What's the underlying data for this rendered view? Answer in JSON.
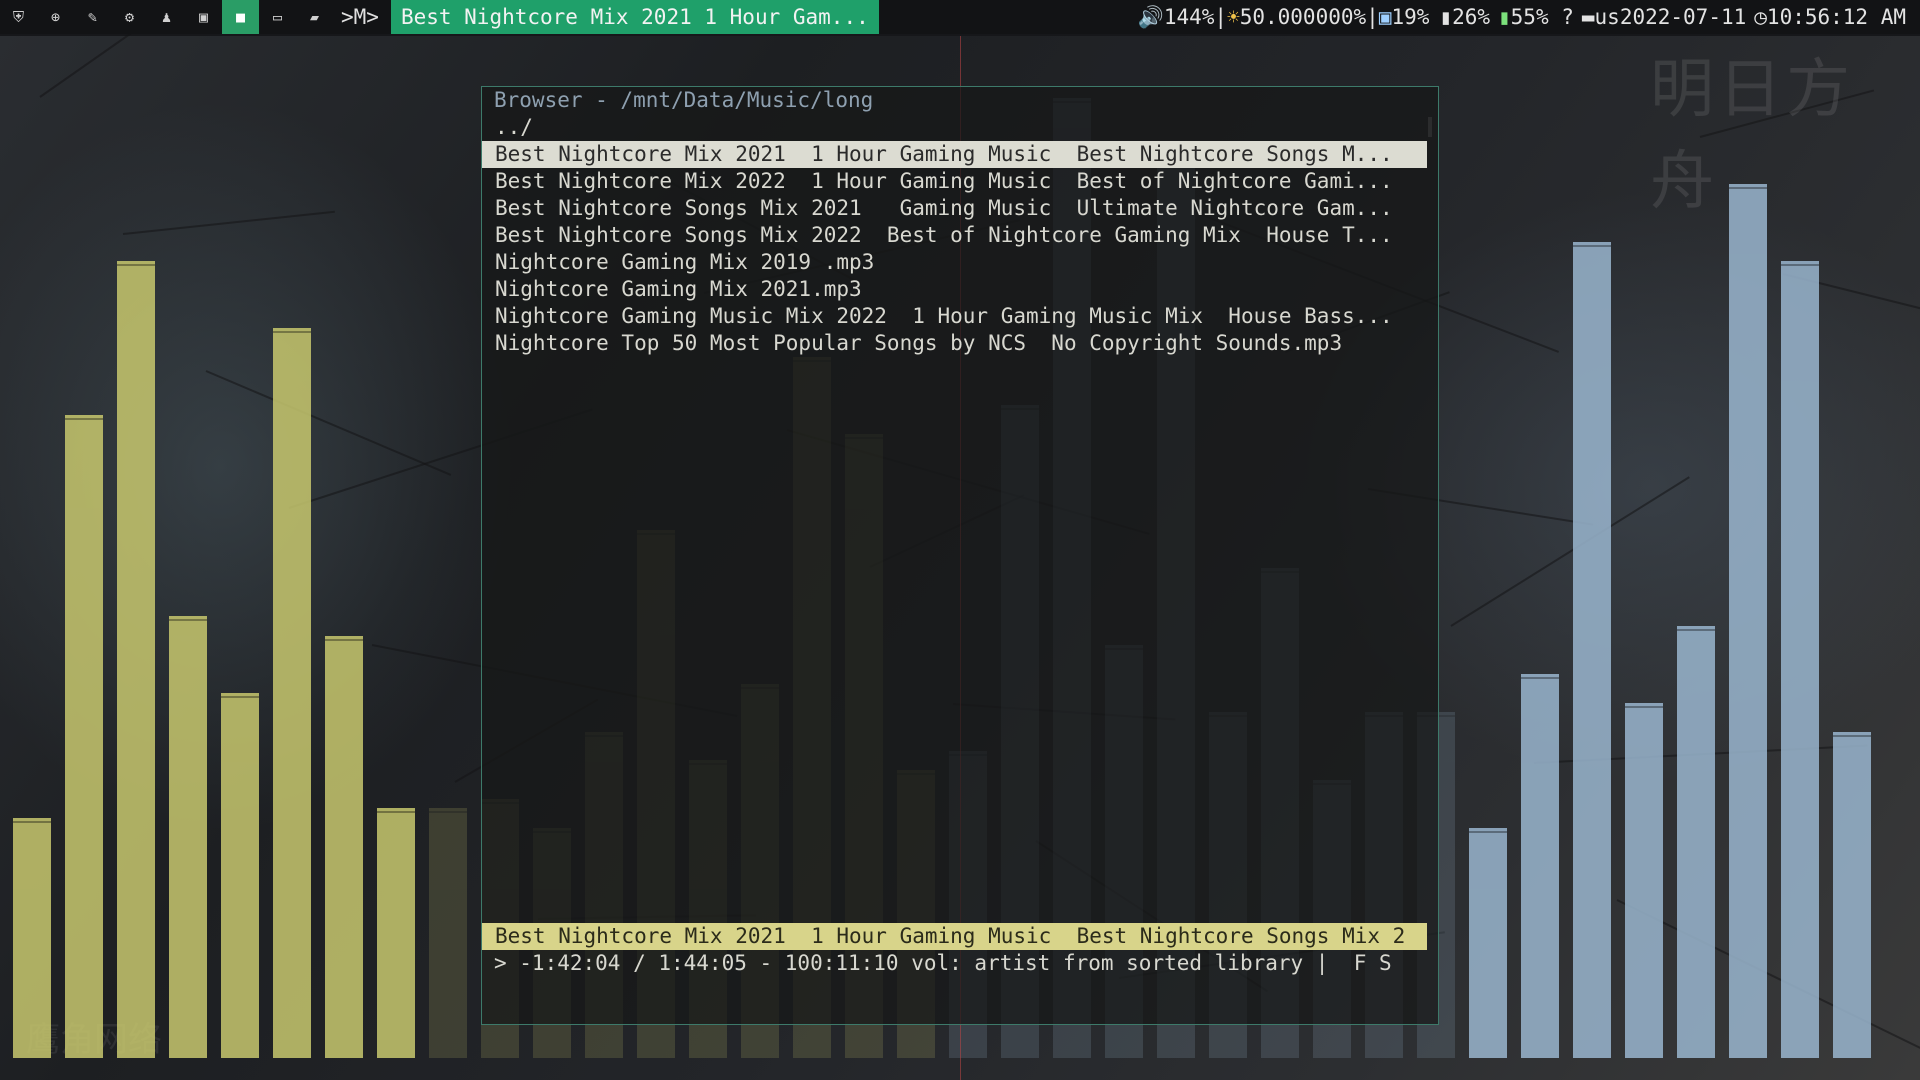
{
  "topbar": {
    "workspaces": [
      {
        "icon": "shield-icon",
        "glyph": "⛨"
      },
      {
        "icon": "globe-icon",
        "glyph": "⊕"
      },
      {
        "icon": "pen-icon",
        "glyph": "✎"
      },
      {
        "icon": "settings-icon",
        "glyph": "⚙"
      },
      {
        "icon": "user-icon",
        "glyph": "♟"
      },
      {
        "icon": "image-icon",
        "glyph": "▣"
      },
      {
        "icon": "video-icon",
        "glyph": "■"
      },
      {
        "icon": "monitor-icon",
        "glyph": "▭"
      },
      {
        "icon": "folder-icon",
        "glyph": "▰"
      }
    ],
    "active_workspace": 6,
    "layout_label": ">M>",
    "window_title": "Best Nightcore Mix 2021  1 Hour Gam...",
    "status": {
      "volume_icon": "speaker-icon",
      "volume": "144%",
      "sep1": " | ",
      "brightness_icon": "sun-icon",
      "brightness": "50.000000%",
      "sep2": " | ",
      "cpu_icon": "robot-icon",
      "cpu": "19%",
      "mem_icon": "memory-icon",
      "mem": " 26%",
      "battery_icon": "battery-icon",
      "battery": "55% ?",
      "keyboard_icon": "keyboard-icon",
      "keyboard_layout": "us",
      "date": " 2022-07-11",
      "clock_icon": "clock-icon",
      "time": "10:56:12 AM"
    }
  },
  "player": {
    "header": "Browser - /mnt/Data/Music/long",
    "parent": "../",
    "entries": [
      "Best Nightcore Mix 2021  1 Hour Gaming Music  Best Nightcore Songs M...",
      "Best Nightcore Mix 2022  1 Hour Gaming Music  Best of Nightcore Gami...",
      "Best Nightcore Songs Mix 2021   Gaming Music  Ultimate Nightcore Gam...",
      "Best Nightcore Songs Mix 2022  Best of Nightcore Gaming Mix  House T...",
      "Nightcore Gaming Mix 2019 .mp3",
      "Nightcore Gaming Mix 2021.mp3",
      "Nightcore Gaming Music Mix 2022  1 Hour Gaming Music Mix  House Bass...",
      "Nightcore Top 50 Most Popular Songs by NCS  No Copyright Sounds.mp3"
    ],
    "selected_index": 0,
    "now_playing": "Best Nightcore Mix 2021  1 Hour Gaming Music  Best Nightcore Songs Mix 2",
    "progress_line": "> -1:42:04 / 1:44:05 - 100:11:10 vol: artist from sorted library |  F S"
  },
  "visualizer": {
    "bar_levels": [
      0.25,
      0.67,
      0.83,
      0.46,
      0.38,
      0.76,
      0.44,
      0.26,
      0.26,
      0.27,
      0.24,
      0.34,
      0.55,
      0.31,
      0.39,
      0.73,
      0.65,
      0.3,
      0.32,
      0.68,
      1.0,
      0.43,
      0.94,
      0.36,
      0.51,
      0.29,
      0.36,
      0.36,
      0.24,
      0.4,
      0.85,
      0.37,
      0.45,
      0.91,
      0.83,
      0.34
    ],
    "yellow": "#c8c86e",
    "blue": "#9ab6cf"
  },
  "wallpaper_text": {
    "logo": "明日方舟",
    "bottom": "鹰角网络"
  }
}
